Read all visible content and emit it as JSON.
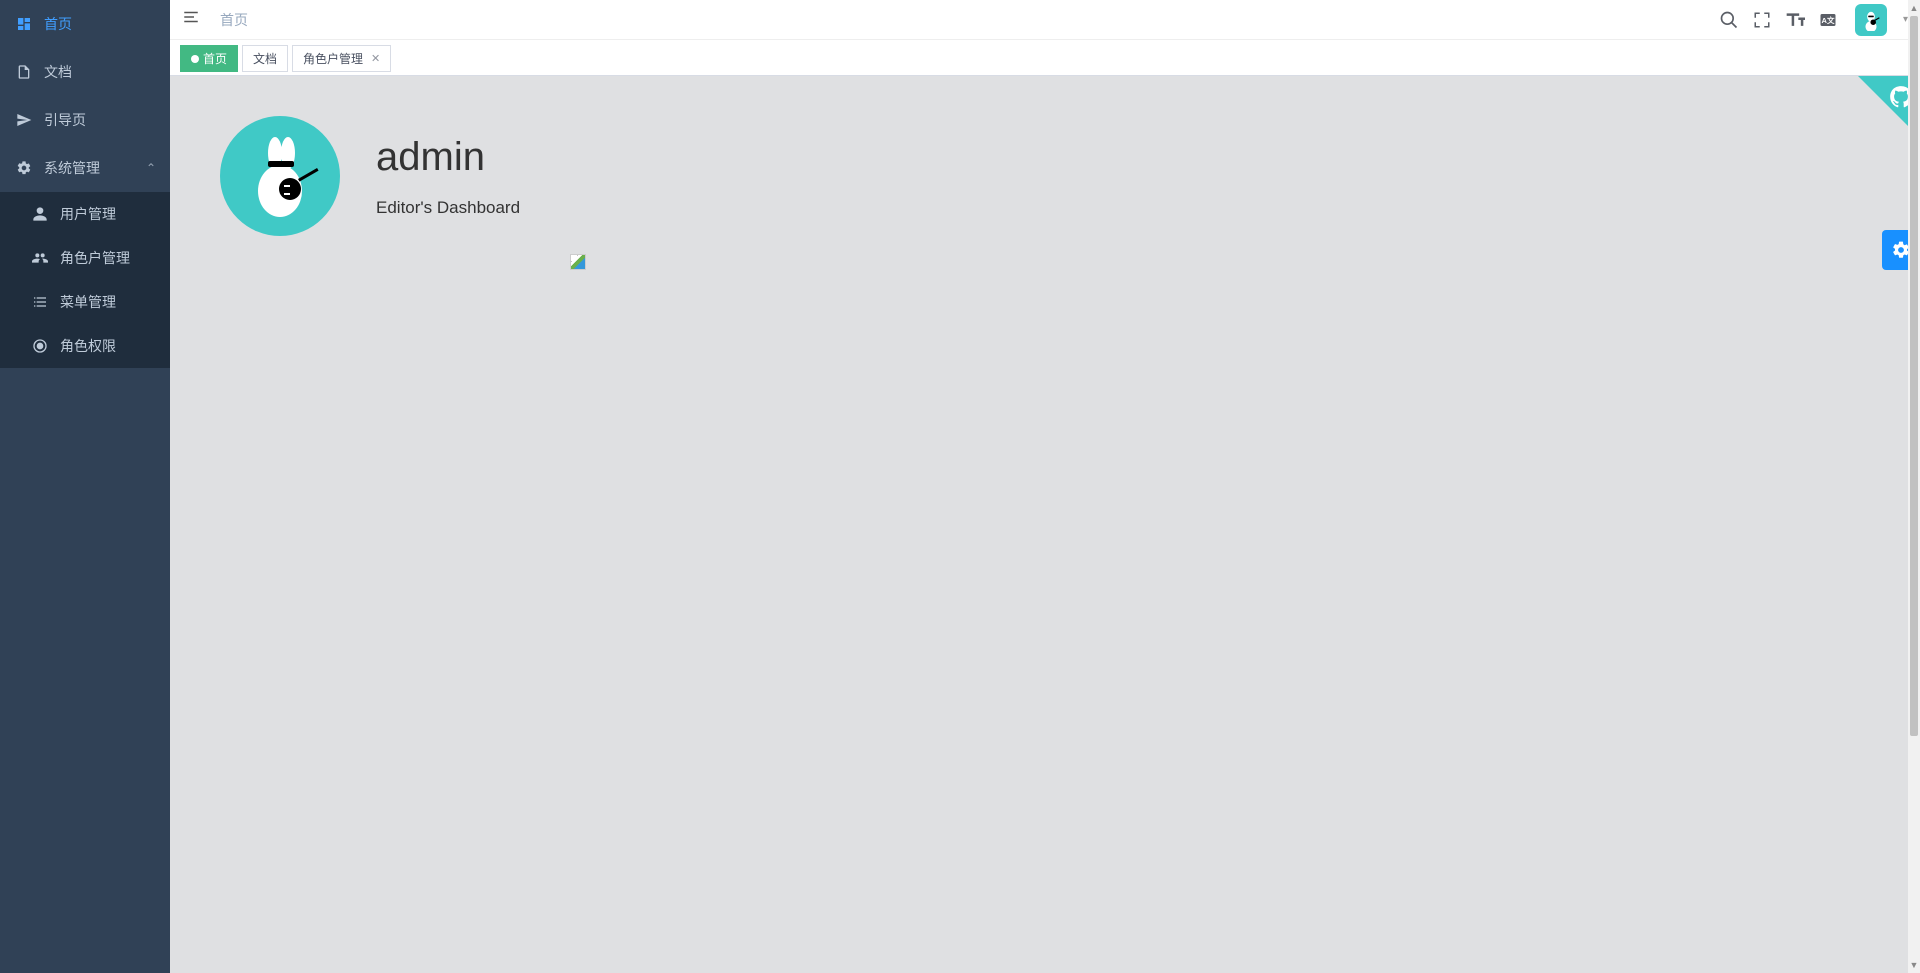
{
  "sidebar": {
    "items": [
      {
        "label": "首页",
        "icon": "dashboard",
        "active": true
      },
      {
        "label": "文档",
        "icon": "document"
      },
      {
        "label": "引导页",
        "icon": "send"
      },
      {
        "label": "系统管理",
        "icon": "gear",
        "expanded": true
      }
    ],
    "subitems": [
      {
        "label": "用户管理",
        "icon": "user"
      },
      {
        "label": "角色户管理",
        "icon": "users"
      },
      {
        "label": "菜单管理",
        "icon": "list"
      },
      {
        "label": "角色权限",
        "icon": "target"
      }
    ]
  },
  "breadcrumb": "首页",
  "tabs": [
    {
      "label": "首页",
      "active": true,
      "closable": false
    },
    {
      "label": "文档",
      "active": false,
      "closable": false
    },
    {
      "label": "角色户管理",
      "active": false,
      "closable": true
    }
  ],
  "profile": {
    "name": "admin",
    "subtitle": "Editor's Dashboard"
  },
  "colors": {
    "accent": "#40c9c6",
    "primary": "#409eff",
    "settings_blue": "#1890ff",
    "tab_green": "#42b983",
    "sidebar_bg": "#304156",
    "sidebar_sub_bg": "#1f2d3d"
  }
}
